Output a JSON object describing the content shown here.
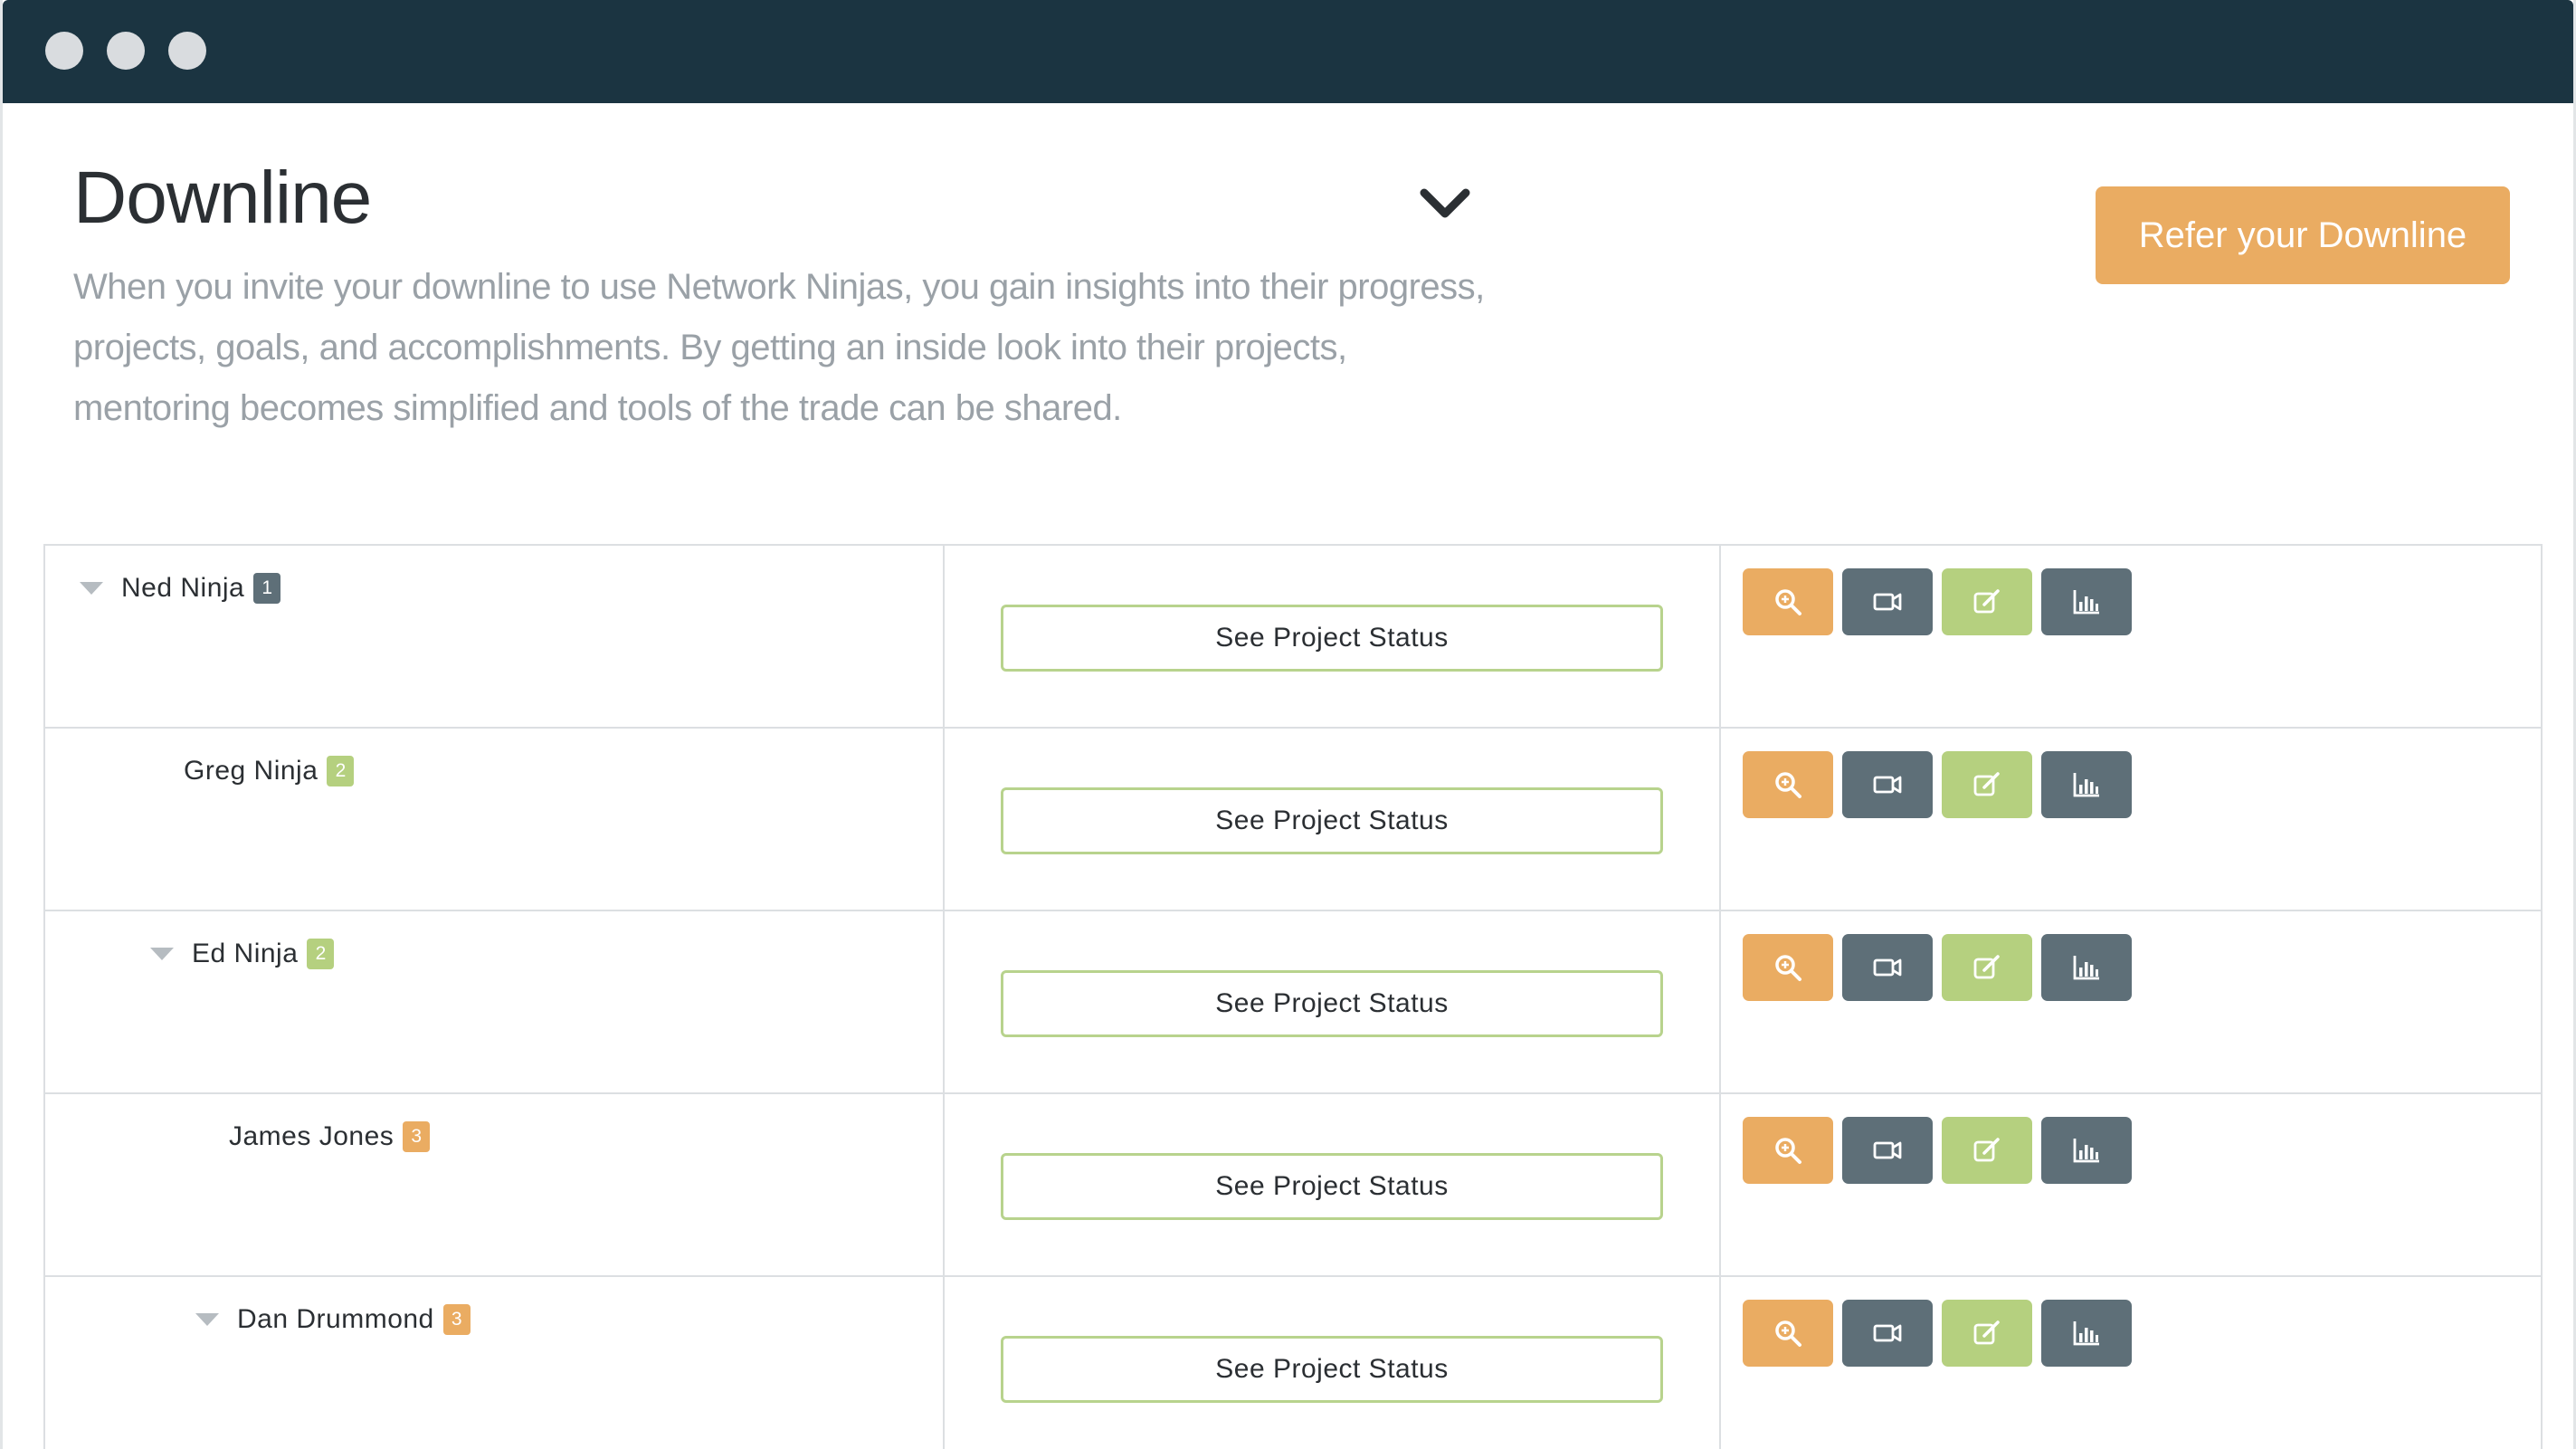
{
  "header": {
    "title": "Downline",
    "description": "When you invite your downline to use Network Ninjas, you gain insights into their progress, projects, goals, and accomplishments. By getting an inside look into their projects, mentoring becomes simplified and tools of the trade can be shared.",
    "refer_button": "Refer your Downline",
    "collapse_icon": "chevron-down-icon"
  },
  "colors": {
    "titlebar": "#1b3441",
    "accent_orange": "#eaac62",
    "slate": "#5e6f78",
    "green": "#b5d07f",
    "badge_level_1": "#5e6f78",
    "badge_level_2": "#b5d07f",
    "badge_level_3": "#eaac62"
  },
  "rows": [
    {
      "name": "Ned Ninja",
      "level": "1",
      "expandable": true,
      "status_label": "See Project Status"
    },
    {
      "name": "Greg Ninja",
      "level": "2",
      "expandable": false,
      "status_label": "See Project Status"
    },
    {
      "name": "Ed Ninja",
      "level": "2",
      "expandable": true,
      "status_label": "See Project Status"
    },
    {
      "name": "James Jones",
      "level": "3",
      "expandable": false,
      "status_label": "See Project Status"
    },
    {
      "name": "Dan Drummond",
      "level": "3",
      "expandable": true,
      "status_label": "See Project Status"
    }
  ],
  "row_actions": [
    "zoom-icon",
    "video-icon",
    "edit-icon",
    "chart-icon"
  ]
}
